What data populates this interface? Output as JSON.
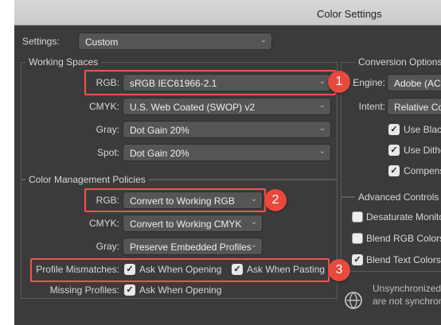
{
  "window": {
    "title": "Color Settings"
  },
  "settings": {
    "label": "Settings:",
    "value": "Custom"
  },
  "working_spaces": {
    "title": "Working Spaces",
    "rgb": {
      "label": "RGB:",
      "value": "sRGB IEC61966-2.1"
    },
    "cmyk": {
      "label": "CMYK:",
      "value": "U.S. Web Coated (SWOP) v2"
    },
    "gray": {
      "label": "Gray:",
      "value": "Dot Gain 20%"
    },
    "spot": {
      "label": "Spot:",
      "value": "Dot Gain 20%"
    }
  },
  "policies": {
    "title": "Color Management Policies",
    "rgb": {
      "label": "RGB:",
      "value": "Convert to Working RGB"
    },
    "cmyk": {
      "label": "CMYK:",
      "value": "Convert to Working CMYK"
    },
    "gray": {
      "label": "Gray:",
      "value": "Preserve Embedded Profiles"
    },
    "mismatch": {
      "label": "Profile Mismatches:",
      "opening": "Ask When Opening",
      "pasting": "Ask When Pasting"
    },
    "missing": {
      "label": "Missing Profiles:",
      "opening": "Ask When Opening"
    }
  },
  "conversion": {
    "title": "Conversion Options",
    "engine": {
      "label": "Engine:",
      "value": "Adobe (ACE"
    },
    "intent": {
      "label": "Intent:",
      "value": "Relative Col"
    },
    "use_black": "Use Black",
    "use_dither": "Use Dithe",
    "compensate": "Compens"
  },
  "advanced": {
    "title": "Advanced Controls",
    "desaturate": "Desaturate Monito",
    "blend_rgb": "Blend RGB Colors",
    "blend_text": "Blend Text Colors"
  },
  "unsync": {
    "line1": "Unsynchronized",
    "line2": "are not synchron"
  },
  "badges": {
    "b1": "1",
    "b2": "2",
    "b3": "3"
  },
  "colors": {
    "highlight": "#f0544f",
    "badge": "#e8493c"
  }
}
